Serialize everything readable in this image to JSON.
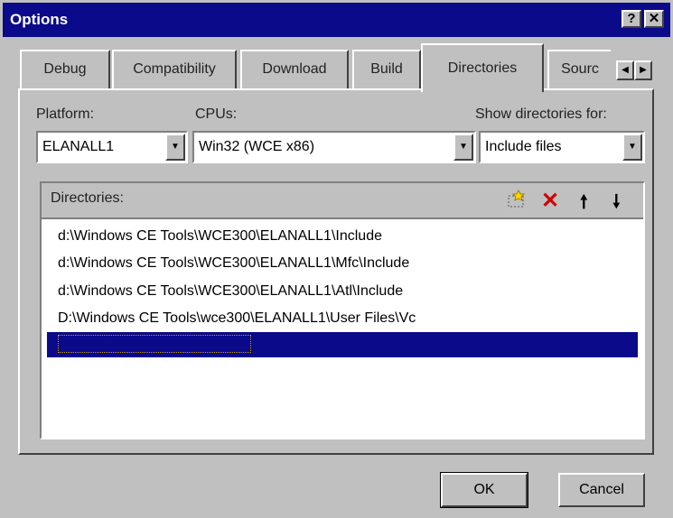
{
  "dialog": {
    "title": "Options",
    "help_label": "?",
    "close_label": "✕"
  },
  "tabs": [
    "Debug",
    "Compatibility",
    "Download",
    "Build",
    "Directories",
    "Sourc"
  ],
  "tab_scroll": {
    "left": "◀",
    "right": "▶"
  },
  "platform": {
    "label": "Platform:",
    "value": "ELANALL1"
  },
  "cpus": {
    "label": "CPUs:",
    "value": "Win32 (WCE x86)"
  },
  "show_for": {
    "label": "Show directories for:",
    "value": "Include files"
  },
  "directories": {
    "label": "Directories:",
    "items": [
      "d:\\Windows CE Tools\\WCE300\\ELANALL1\\Include",
      "d:\\Windows CE Tools\\WCE300\\ELANALL1\\Mfc\\Include",
      "d:\\Windows CE Tools\\WCE300\\ELANALL1\\Atl\\Include",
      "D:\\Windows CE Tools\\wce300\\ELANALL1\\User Files\\Vc"
    ]
  },
  "buttons": {
    "ok": "OK",
    "cancel": "Cancel"
  },
  "icons": {
    "new": "new-folder-icon",
    "delete": "delete-icon",
    "up": "move-up-icon",
    "down": "move-down-icon"
  },
  "colors": {
    "titlebar": "#0a0a8a",
    "selection": "#0a0a8a",
    "face": "#c0c0c0"
  }
}
